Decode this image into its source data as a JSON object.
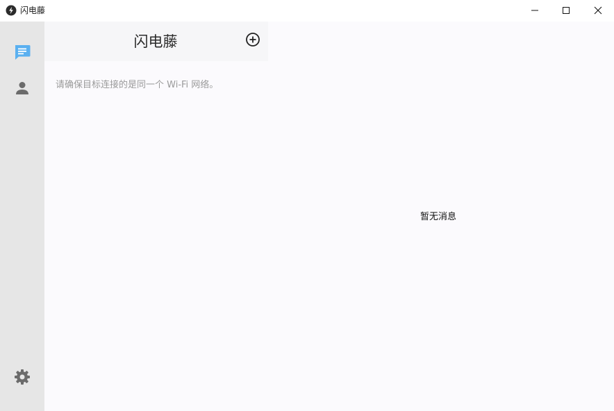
{
  "window": {
    "title": "闪电藤"
  },
  "icons": {
    "app": "lightning-logo-icon",
    "minimize": "minimize-icon",
    "maximize": "maximize-icon",
    "close": "close-icon",
    "chat": "chat-bubble-icon",
    "contacts": "person-icon",
    "settings": "gear-icon",
    "add": "plus-circle-icon"
  },
  "colors": {
    "accent": "#5ab0f0",
    "sidebar_bg": "#e6e6e6",
    "icon_gray": "#6b6b6b",
    "hint_text": "#9a9a9a"
  },
  "list_panel": {
    "title": "闪电藤",
    "hint": "请确保目标连接的是同一个 Wi-Fi 网络。"
  },
  "main": {
    "empty_text": "暂无消息"
  }
}
